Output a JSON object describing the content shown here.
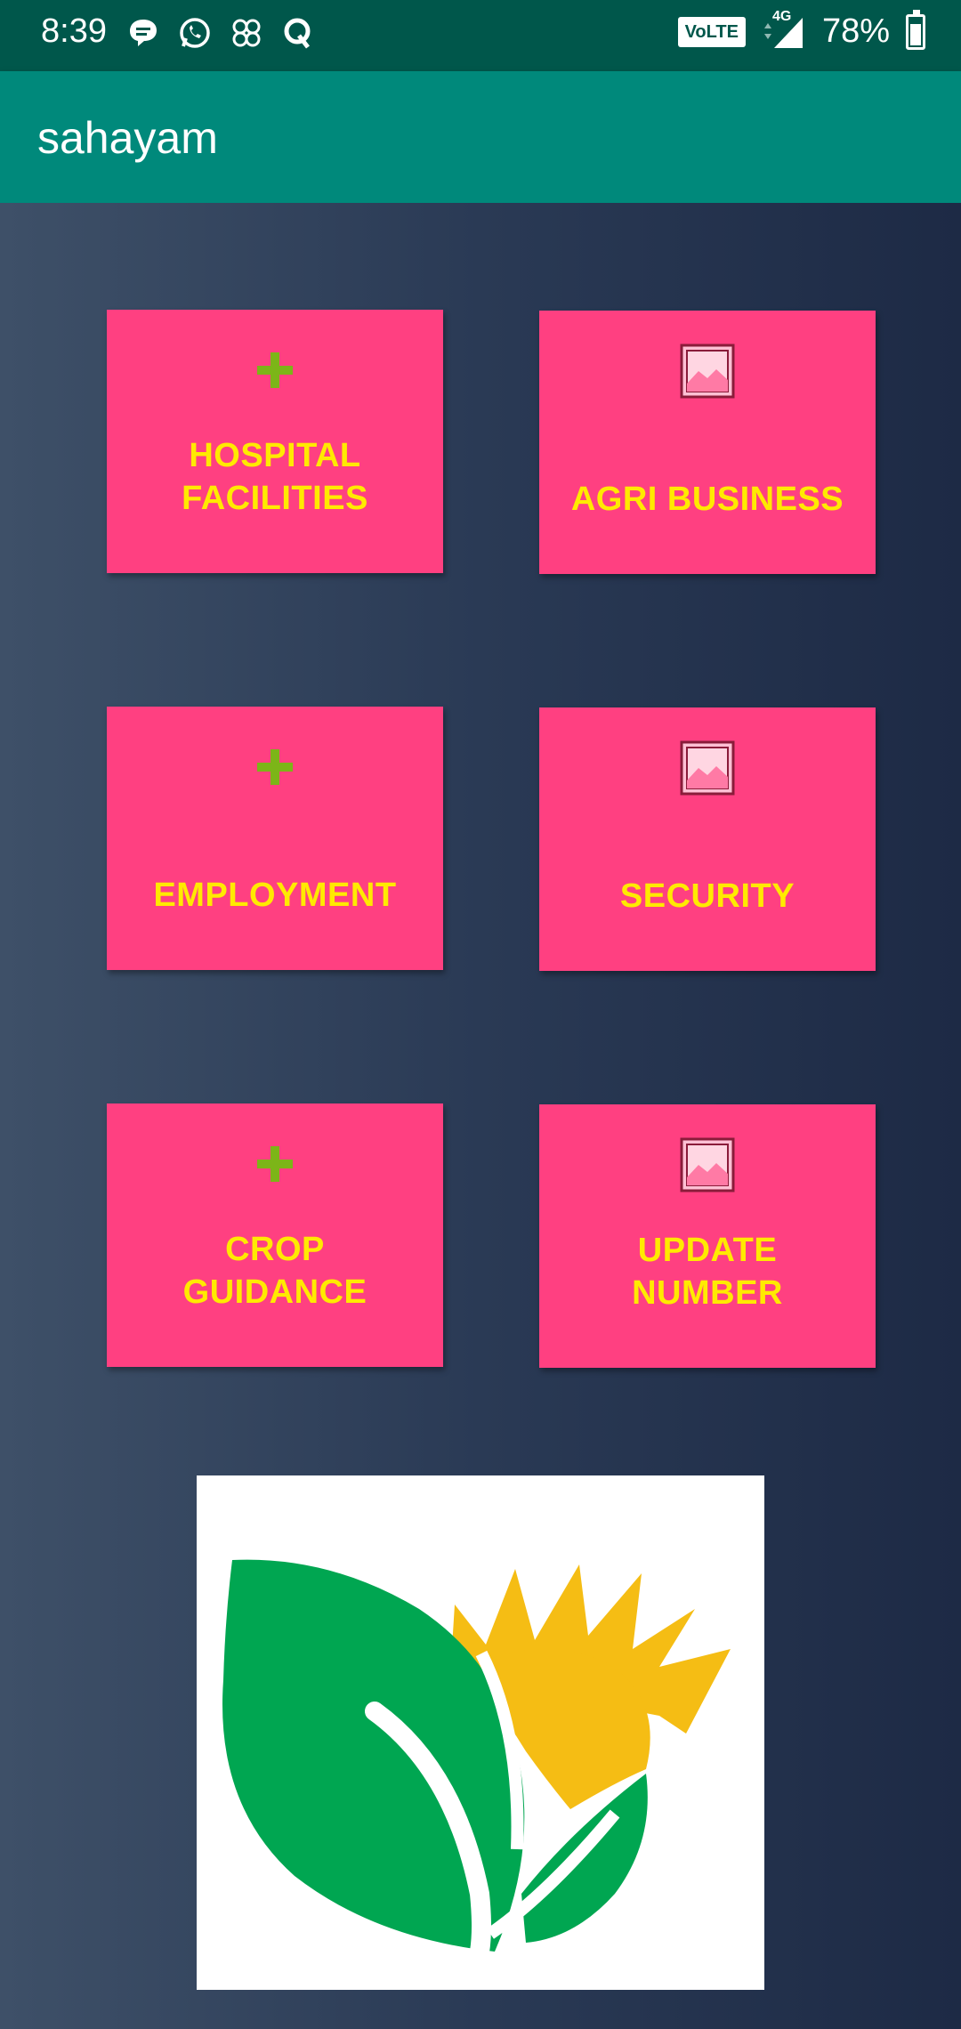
{
  "status_bar": {
    "time": "8:39",
    "network": "4G",
    "volte": "VoLTE",
    "battery": "78%"
  },
  "app_bar": {
    "title": "sahayam"
  },
  "tiles": [
    {
      "label": "HOSPITAL\nFACILITIES",
      "icon": "plus-icon"
    },
    {
      "label": "AGRI BUSINESS",
      "icon": "image-placeholder-icon"
    },
    {
      "label": "EMPLOYMENT",
      "icon": "plus-icon"
    },
    {
      "label": "SECURITY",
      "icon": "image-placeholder-icon"
    },
    {
      "label": "CROP\nGUIDANCE",
      "icon": "plus-icon"
    },
    {
      "label": "UPDATE\nNUMBER",
      "icon": "image-placeholder-icon"
    }
  ],
  "colors": {
    "status_bar": "#00574b",
    "app_bar": "#00897b",
    "tile": "#ff4081",
    "tile_text": "#ffea00",
    "plus_icon": "#7cb518",
    "logo_leaf": "#00a651",
    "logo_sun": "#f5bd14"
  }
}
